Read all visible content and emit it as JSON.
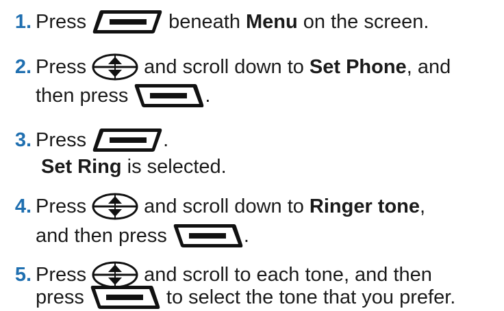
{
  "steps": [
    {
      "number": "1.",
      "pre": "Press",
      "mid": "beneath",
      "bold": "Menu",
      "post": "on the screen."
    },
    {
      "number": "2.",
      "pre": "Press",
      "mid": "and scroll down to",
      "bold": "Set Phone",
      "post": ", and",
      "line2_pre": "then press",
      "line2_post": "."
    },
    {
      "number": "3.",
      "pre": "Press",
      "post": ".",
      "line2_bold": "Set Ring",
      "line2_post": "is selected."
    },
    {
      "number": "4.",
      "pre": "Press",
      "mid": "and scroll down to",
      "bold": "Ringer tone",
      "post": ",",
      "line2_pre": "and then press",
      "line2_post": "."
    },
    {
      "number": "5.",
      "pre": "Press",
      "mid": "and scroll to each tone, and then",
      "line2_pre": "press",
      "line2_post": "to select the tone that you prefer."
    }
  ],
  "icons": {
    "left_softkey": "left-softkey-icon",
    "right_softkey": "right-softkey-icon",
    "nav_key": "navigation-key-icon"
  },
  "colors": {
    "step_number": "#1f6fb0",
    "text": "#1a1a1a",
    "icon": "#111111"
  }
}
